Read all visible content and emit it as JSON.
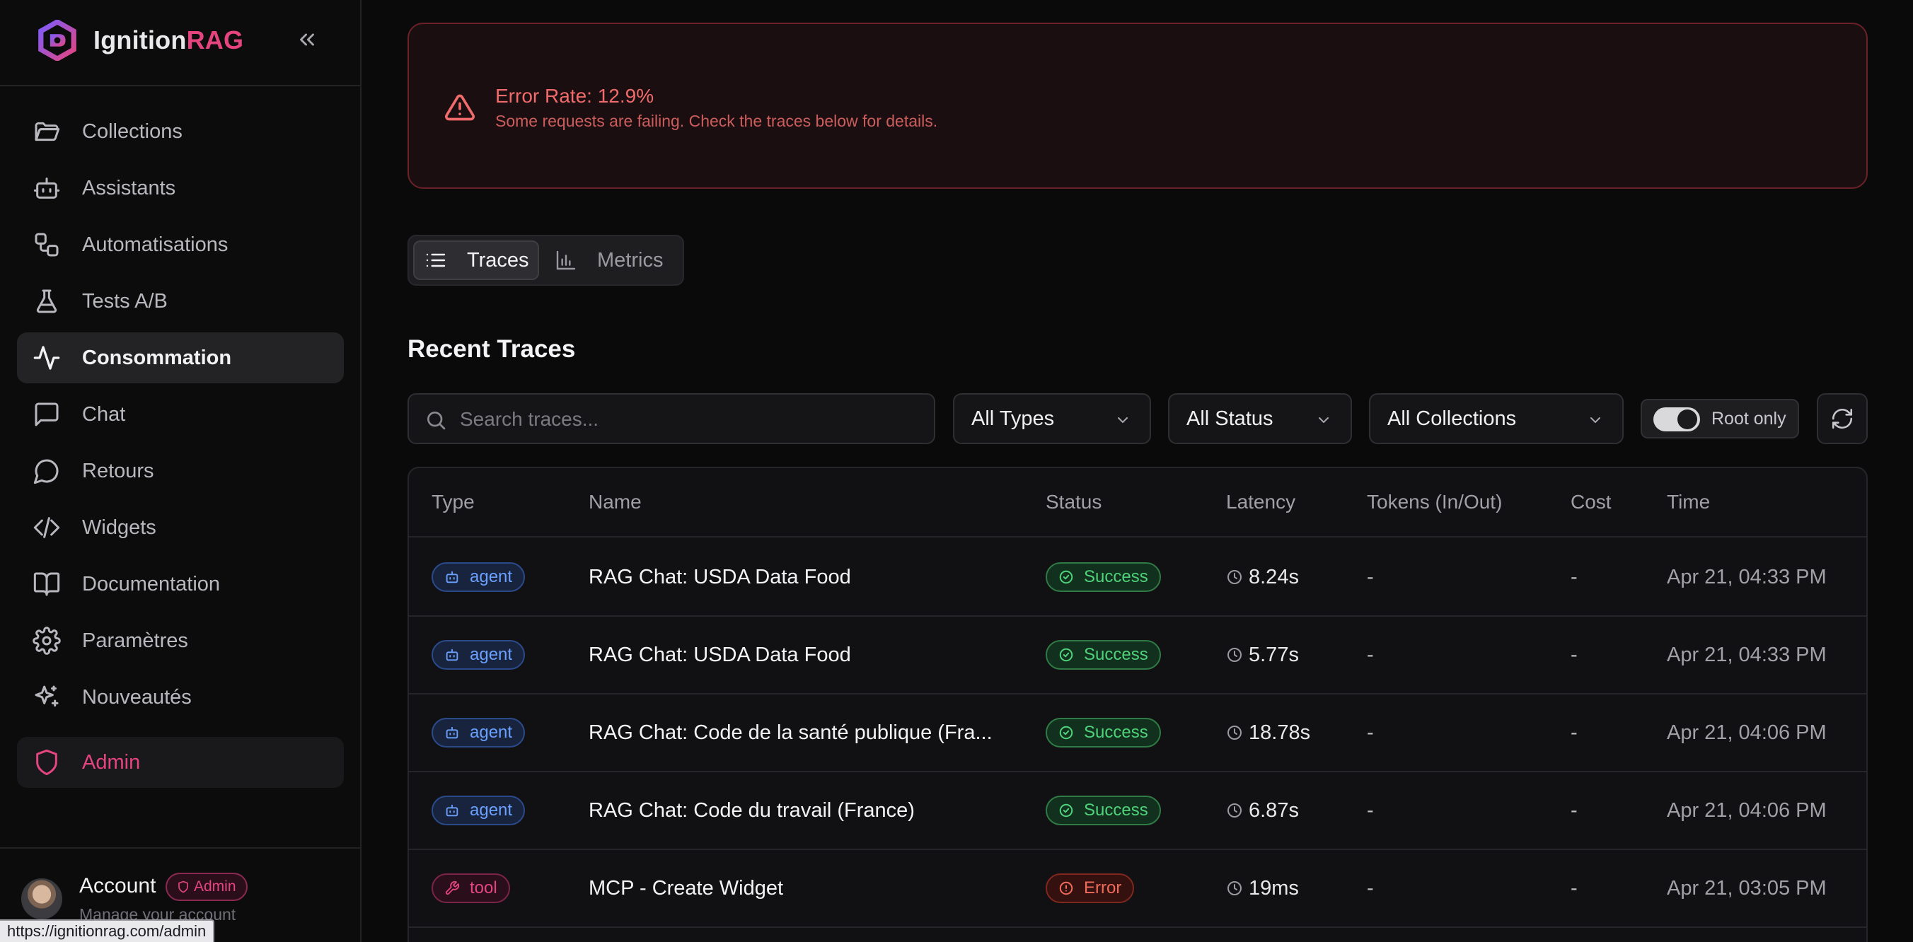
{
  "brand": {
    "name_prefix": "Ignition",
    "name_suffix": "RAG"
  },
  "sidebar": {
    "items": [
      {
        "label": "Collections",
        "icon": "folder-icon"
      },
      {
        "label": "Assistants",
        "icon": "bot-icon"
      },
      {
        "label": "Automatisations",
        "icon": "workflow-icon"
      },
      {
        "label": "Tests A/B",
        "icon": "flask-icon"
      },
      {
        "label": "Consommation",
        "icon": "activity-icon",
        "active": true
      },
      {
        "label": "Chat",
        "icon": "message-square-icon"
      },
      {
        "label": "Retours",
        "icon": "message-circle-icon"
      },
      {
        "label": "Widgets",
        "icon": "code-icon"
      },
      {
        "label": "Documentation",
        "icon": "book-icon"
      },
      {
        "label": "Paramètres",
        "icon": "gear-icon"
      },
      {
        "label": "Nouveautés",
        "icon": "sparkles-icon"
      }
    ],
    "admin_label": "Admin"
  },
  "account": {
    "name": "Account",
    "badge": "Admin",
    "subtitle": "Manage your account"
  },
  "status_bar_url": "https://ignitionrag.com/admin",
  "alert": {
    "title": "Error Rate: 12.9%",
    "message": "Some requests are failing. Check the traces below for details."
  },
  "tabs": {
    "traces": "Traces",
    "metrics": "Metrics",
    "selected": "Traces"
  },
  "section_title": "Recent Traces",
  "filters": {
    "search_placeholder": "Search traces...",
    "types": "All Types",
    "status": "All Status",
    "collections": "All Collections",
    "root_only_label": "Root only",
    "root_only": true
  },
  "table": {
    "headers": {
      "type": "Type",
      "name": "Name",
      "status": "Status",
      "latency": "Latency",
      "tokens": "Tokens (In/Out)",
      "cost": "Cost",
      "time": "Time"
    },
    "rows": [
      {
        "type": "agent",
        "name": "RAG Chat: USDA Data Food",
        "status": "Success",
        "latency": "8.24s",
        "tokens": "-",
        "cost": "-",
        "time": "Apr 21, 04:33 PM"
      },
      {
        "type": "agent",
        "name": "RAG Chat: USDA Data Food",
        "status": "Success",
        "latency": "5.77s",
        "tokens": "-",
        "cost": "-",
        "time": "Apr 21, 04:33 PM"
      },
      {
        "type": "agent",
        "name": "RAG Chat: Code de la santé publique (Fra...",
        "status": "Success",
        "latency": "18.78s",
        "tokens": "-",
        "cost": "-",
        "time": "Apr 21, 04:06 PM"
      },
      {
        "type": "agent",
        "name": "RAG Chat: Code du travail (France)",
        "status": "Success",
        "latency": "6.87s",
        "tokens": "-",
        "cost": "-",
        "time": "Apr 21, 04:06 PM"
      },
      {
        "type": "tool",
        "name": "MCP - Create Widget",
        "status": "Error",
        "latency": "19ms",
        "tokens": "-",
        "cost": "-",
        "time": "Apr 21, 03:05 PM"
      }
    ]
  },
  "colors": {
    "accent": "#e5457e",
    "success": "#4fd27a",
    "error": "#f06b6b",
    "agent": "#6aa1ff"
  }
}
